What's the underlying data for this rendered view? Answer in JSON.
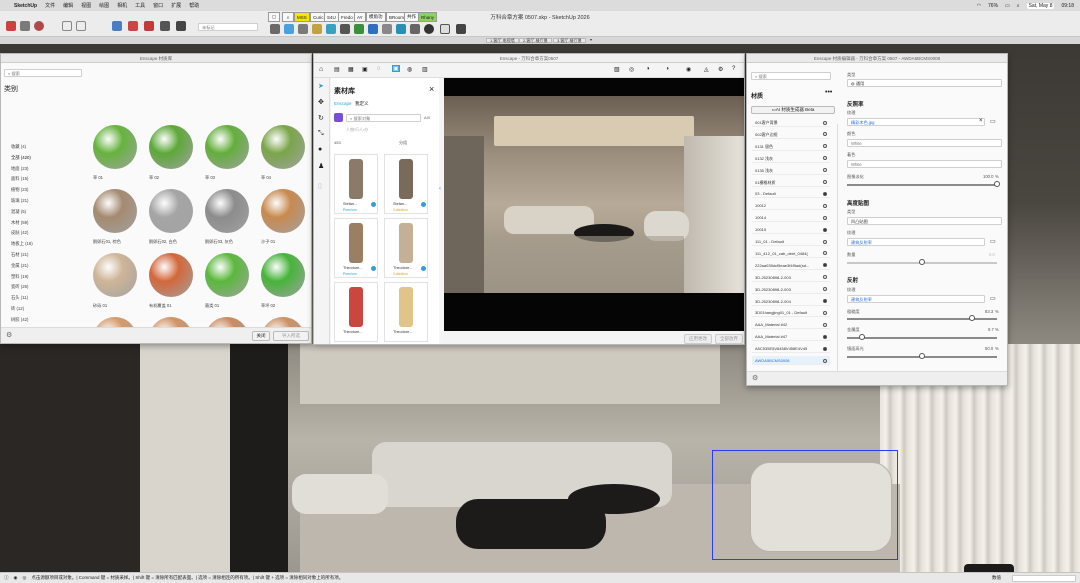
{
  "menubar": {
    "app": "SketchUp",
    "items": [
      "文件",
      "编辑",
      "视图",
      "绘图",
      "相机",
      "工具",
      "窗口",
      "扩展",
      "帮助"
    ],
    "battery": "76%",
    "datetime": "Sat, May 8",
    "time": "09:18"
  },
  "toolbar": {
    "doc_title": "万科合章方案 0507.skp - SketchUp 2026",
    "layer_select": "未标记",
    "plugins": [
      "MSS",
      "Curic",
      "S4U",
      "Fredo",
      "AY",
      "模角功",
      "BRoom",
      "共作",
      "Rhany"
    ]
  },
  "scene_tabs": [
    "1.客厅-电视墙",
    "2.客厅-餐厅景",
    "3.客厅-餐厅景"
  ],
  "statusbar": {
    "hint": "点击源额项目或对象。| Command 键 = 材质采样。| Shift 键 = 清除所有匹配表面。| 选项 = 清除相连的所有项。| Shift 键 + 选项 = 清除相同对象上的所有项。",
    "right_label": "数值"
  },
  "enscape_mats": {
    "title": "Enscape 材质库",
    "search_placeholder": "搜索",
    "category_header": "类别",
    "categories": [
      "收藏 (4)",
      "全部 (420)",
      "地面 (23)",
      "面料 (15)",
      "植物 (23)",
      "玻璃 (21)",
      "混凝 (5)",
      "木材 (59)",
      "皮肤 (42)",
      "地板上 (18)",
      "石材 (21)",
      "金属 (21)",
      "塑料 (19)",
      "瓷砖 (26)",
      "石头 (11)",
      "砖 (12)",
      "树胶 (42)",
      "地毯 (23)",
      "墙纸 (21)",
      "金属 (46)",
      "其他 (0)"
    ],
    "materials": [
      {
        "label": "草 01",
        "color": "#66b33d"
      },
      {
        "label": "草 02",
        "color": "#5da838"
      },
      {
        "label": "草 03",
        "color": "#63ae3b"
      },
      {
        "label": "草 04",
        "color": "#7aa54a"
      },
      {
        "label": "鹅卵石01, 棕色",
        "color": "#a48a70"
      },
      {
        "label": "鹅卵石02, 白色",
        "color": "#a5a5a5"
      },
      {
        "label": "鹅卵石03, 灰色",
        "color": "#8c8c8c"
      },
      {
        "label": "沙子 01",
        "color": "#c8894f"
      },
      {
        "label": "砂砾 01",
        "color": "#cfb597"
      },
      {
        "label": "有机覆盖 01",
        "color": "#d3673a"
      },
      {
        "label": "蕨类 01",
        "color": "#5ab83c"
      },
      {
        "label": "草坪 02",
        "color": "#46b43a"
      },
      {
        "label": "土壤 01, 有裂",
        "color": "#d59a6a"
      },
      {
        "label": "土壤 02",
        "color": "#d29466"
      },
      {
        "label": "土壤 03, 干燥",
        "color": "#c98b62"
      },
      {
        "label": "土壤 04",
        "color": "#cc9165"
      }
    ],
    "close_button": "关闭",
    "import_button": "导入所选"
  },
  "asset_lib": {
    "title": "Enscape - 万科合章方案0507",
    "header": "素材库",
    "tabs": [
      "Enscape",
      "我定义"
    ],
    "search_placeholder": "搜索对象",
    "sub_label": "人物/行人/办",
    "count": "453",
    "sort": "分组",
    "people": [
      {
        "name": "Stefan...",
        "tag": "Premium"
      },
      {
        "name": "Stefan...",
        "tag": "Collection"
      },
      {
        "name": "Theodore...",
        "tag": "Premium"
      },
      {
        "name": "Theodore...",
        "tag": "Collection"
      },
      {
        "name": "Theodore...",
        "tag": ""
      },
      {
        "name": "Theodore...",
        "tag": ""
      }
    ],
    "apply_button": "应用更改",
    "all_button": "全部放弃"
  },
  "mat_editor": {
    "title": "Enscape 材质编辑器 - 万科合章方案 0507 - AWDA5BCMS0008",
    "list_header": "材质",
    "search_placeholder": "搜索",
    "ai_button": "AI 材质生成器 Beta",
    "list": [
      "001客户背景",
      "002客户边框",
      "0131 银色",
      "0132 浅灰",
      "0135 浅灰",
      "01栅格材质",
      "03 - Default",
      "10012",
      "10014",
      "10015",
      "111_01 - Default",
      "111_412_01_cab_dent_0484(",
      "222aa035dcf5eae3f4f9ad(sd...",
      "3D-25230898-2-003",
      "3D-25230898-2-003",
      "3D-25230898-2-004",
      "3D01hangjing01_01 - Default",
      "AAA_Material #42",
      "AAA_Material #47",
      "A5C535E5V8458V458E4V45",
      "AWDA5BCMS0008"
    ],
    "type_label": "类型",
    "type_value": "通用",
    "reflectance_title": "反照率",
    "texture_label": "纹理",
    "texture_file": "精彩木色.jpg",
    "color_label": "颜色",
    "color_value": "White",
    "tint_label": "着色",
    "tint_value": "White",
    "brightness_label": "图像淡化",
    "brightness_value": "100.0",
    "height_title": "高度贴图",
    "height_type_label": "类型",
    "height_type_value": "凹凸贴图",
    "height_texture_label": "纹理",
    "height_texture_file": "建筑反射率",
    "amount_label": "数量",
    "amount_value": "0.0",
    "reflect_title": "反射",
    "reflect_texture_label": "纹理",
    "reflect_texture_file": "建筑反射率",
    "roughness_label": "粗糙度",
    "roughness_value": "83.3",
    "metal_label": "金属度",
    "metal_value": "9.7",
    "specular_label": "镜面高光",
    "specular_value": "50.0",
    "percent": "%"
  }
}
